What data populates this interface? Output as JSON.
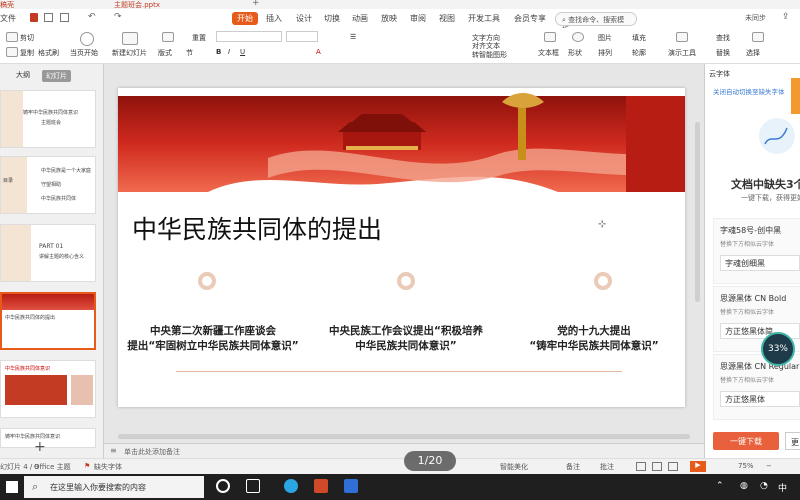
{
  "titlebar": {
    "doc_tab": "稿壳",
    "file_tab": "主题班会.pptx"
  },
  "menubar": {
    "file": "文件",
    "tabs": [
      "开始",
      "插入",
      "设计",
      "切换",
      "动画",
      "放映",
      "审阅",
      "视图",
      "开发工具",
      "会员专享"
    ],
    "search_placeholder": "查找命令、搜索模板",
    "cloud": "未同步"
  },
  "ribbon": {
    "cut": "剪切",
    "copy": "复制",
    "format_painter": "格式刷",
    "from_current": "当页开始",
    "new_slide": "新建幻灯片",
    "layout": "版式",
    "section": "节",
    "reset": "重置",
    "text_dir": "文字方向",
    "align_text": "对齐文本",
    "smart_graphic": "转智能图形",
    "textbox": "文本框",
    "shape": "形状",
    "arrange": "排列",
    "picture": "图片",
    "fill": "填充",
    "outline": "轮廓",
    "present_tools": "演示工具",
    "find": "查找",
    "replace": "替换",
    "select": "选择"
  },
  "leftpane": {
    "tabs": [
      "大纲",
      "幻灯片"
    ],
    "thumbs": [
      {
        "title": "铸牢中华民族共同体意识",
        "sub": "主题班会"
      },
      {
        "items": [
          "中华民族是一个大家庭",
          "守望相助",
          "中华民族共同体"
        ],
        "label": "目录"
      },
      {
        "part": "PART 01",
        "sub": "讲解主题的核心含义"
      },
      {
        "title": "中华民族共同体的提出"
      },
      {
        "title": "中华民族共同体意识"
      },
      {
        "title": "铸牢中华民族共同体意识"
      }
    ]
  },
  "slide": {
    "title": "中华民族共同体的提出",
    "columns": [
      {
        "line1": "中央第二次新疆工作座谈会",
        "line2": "提出“牢固树立中华民族共同体意识”"
      },
      {
        "line1": "中央民族工作会议提出“积极培养",
        "line2": "中华民族共同体意识”"
      },
      {
        "line1": "党的十九大提出",
        "line2": "“铸牢中华民族共同体意识”"
      }
    ]
  },
  "notes": {
    "placeholder": "单击此处添加备注"
  },
  "rightpanel": {
    "header": "云字体",
    "link": "关闭自动切换至缺失字体",
    "missing_title": "文档中缺失3个",
    "missing_sub": "一键下载，获得更好的",
    "fonts": [
      {
        "name": "字魂58号-创中黑",
        "sub": "替换下方相似云字体",
        "alt": "字魂创细黑"
      },
      {
        "name": "思源黑体 CN Bold",
        "sub": "替换下方相似云字体",
        "alt": "方正悠黑体简"
      },
      {
        "name": "思源黑体 CN Regular",
        "sub": "替换下方相似云字体",
        "alt": "方正悠黑体"
      }
    ],
    "download": "一键下载",
    "more": "更",
    "progress_badge": "33%"
  },
  "statusbar": {
    "page": "幻灯片 4 / 9",
    "theme": "Office 主题",
    "missing_font": "缺失字体",
    "smart_beautify": "智能美化",
    "notes": "备注",
    "comments": "批注",
    "zoom": "75%"
  },
  "page_indicator": "1/20",
  "taskbar": {
    "search_placeholder": "在这里输入你要搜索的内容",
    "ime": "中"
  }
}
